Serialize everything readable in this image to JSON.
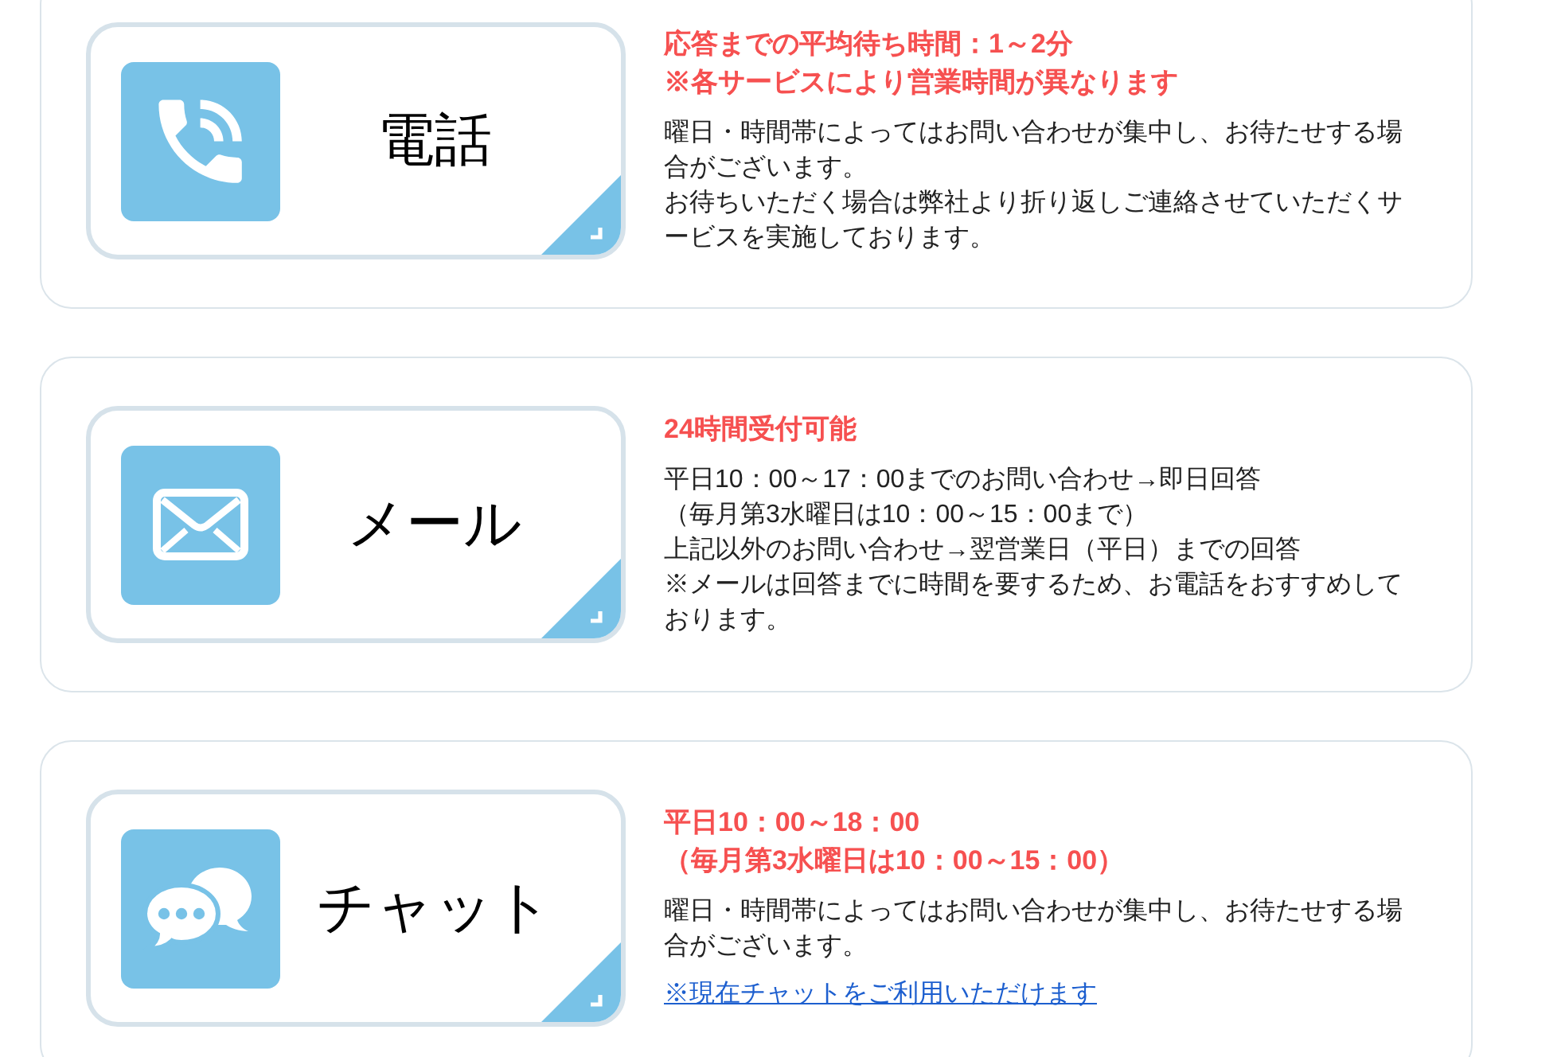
{
  "contact_channels": [
    {
      "kind": "phone",
      "label": "電話",
      "notice": [
        "応答までの平均待ち時間：1～2分",
        "※各サービスにより営業時間が異なります"
      ],
      "body": [
        "曜日・時間帯によってはお問い合わせが集中し、お待たせする場合がございます。",
        "お待ちいただく場合は弊社より折り返しご連絡させていただくサービスを実施しております。"
      ]
    },
    {
      "kind": "mail",
      "label": "メール",
      "notice": [
        "24時間受付可能"
      ],
      "body": [
        "平日10：00～17：00までのお問い合わせ→即日回答",
        "（毎月第3水曜日は10：00～15：00まで）",
        "上記以外のお問い合わせ→翌営業日（平日）までの回答",
        "※メールは回答までに時間を要するため、お電話をおすすめしております。"
      ]
    },
    {
      "kind": "chat",
      "label": "チャット",
      "notice": [
        "平日10：00～18：00",
        "（毎月第3水曜日は10：00～15：00）"
      ],
      "body": [
        "曜日・時間帯によってはお問い合わせが集中し、お待たせする場合がございます。"
      ],
      "link": "※現在チャットをご利用いただけます"
    }
  ]
}
